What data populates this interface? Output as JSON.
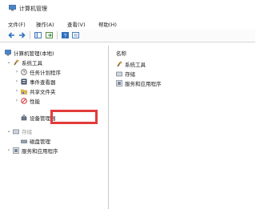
{
  "window": {
    "title": "计算机管理"
  },
  "menu": [
    "文件(F)",
    "操作(A)",
    "查看(V)",
    "帮助(H)"
  ],
  "toolbar": {
    "buttons": [
      "back-icon",
      "forward-icon",
      "show-hide-tree-icon",
      "export-list-icon",
      "help-icon",
      "properties-icon"
    ]
  },
  "tree": {
    "root": "计算机管理(本地)",
    "system_tools": "系统工具",
    "task_scheduler": "任务计划程序",
    "event_viewer": "事件查看器",
    "shared_folders": "共享文件夹",
    "performance": "性能",
    "device_manager": "设备管理器",
    "storage": "存储",
    "disk_management": "磁盘管理",
    "services_apps": "服务和应用程序"
  },
  "right_pane": {
    "column_header": "名称",
    "items": [
      "系统工具",
      "存储",
      "服务和应用程序"
    ]
  },
  "colors": {
    "highlight": "#e23b3b",
    "folder": "#e8b64a",
    "accent": "#3b78c9"
  }
}
